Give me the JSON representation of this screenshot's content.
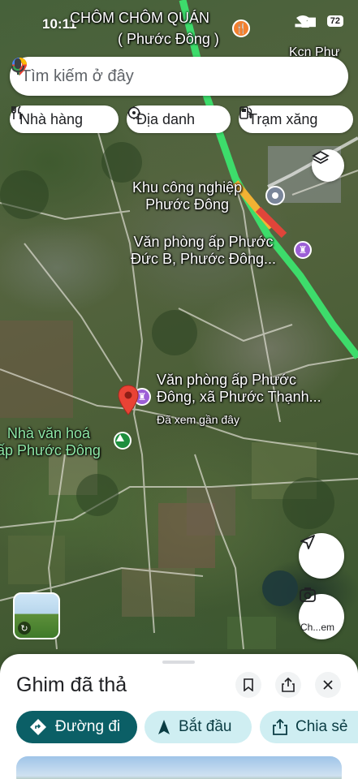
{
  "status_bar": {
    "time": "10:11",
    "battery": "72"
  },
  "map": {
    "labels": {
      "top_title_line1": "CHÔM CHÔM QUÁN",
      "top_title_line2": "( Phước Đông )",
      "kcn_corner": "Kcn Phư",
      "industrial_park_line1": "Khu công nghiệp",
      "industrial_park_line2": "Phước Đông",
      "office_b_line1": "Văn phòng ấp Phước",
      "office_b_line2": "Đức B, Phước Đông...",
      "office_pd_line1": "Văn phòng ấp Phước",
      "office_pd_line2": "Đông, xã Phước Thạnh...",
      "recently_viewed": "Đã xem gần đây",
      "culture_house_line1": "Nhà văn hoá",
      "culture_house_line2": "ấp Phước Đông"
    },
    "colors": {
      "pin": "#e94335",
      "poi_purple": "#9c5fd6",
      "poi_green": "#1e8e3e",
      "road_green": "#3ddc6b",
      "road_red": "#e0453a",
      "road_yellow": "#f2b233"
    },
    "icons": {
      "layers": "layers-icon",
      "locate": "navigation-arrow-icon",
      "lens": "camera-lens-icon"
    },
    "lens_label": "Ch...em"
  },
  "search": {
    "placeholder": "Tìm kiếm ở đây"
  },
  "chips": [
    {
      "label": "Nhà hàng",
      "icon": "fork-knife-icon"
    },
    {
      "label": "Địa danh",
      "icon": "landmark-icon"
    },
    {
      "label": "Trạm xăng",
      "icon": "gas-station-icon"
    }
  ],
  "sheet": {
    "title": "Ghim đã thả",
    "actions": {
      "directions": "Đường đi",
      "start": "Bắt đầu",
      "share": "Chia sẻ"
    },
    "accent": "#0b5f66"
  }
}
